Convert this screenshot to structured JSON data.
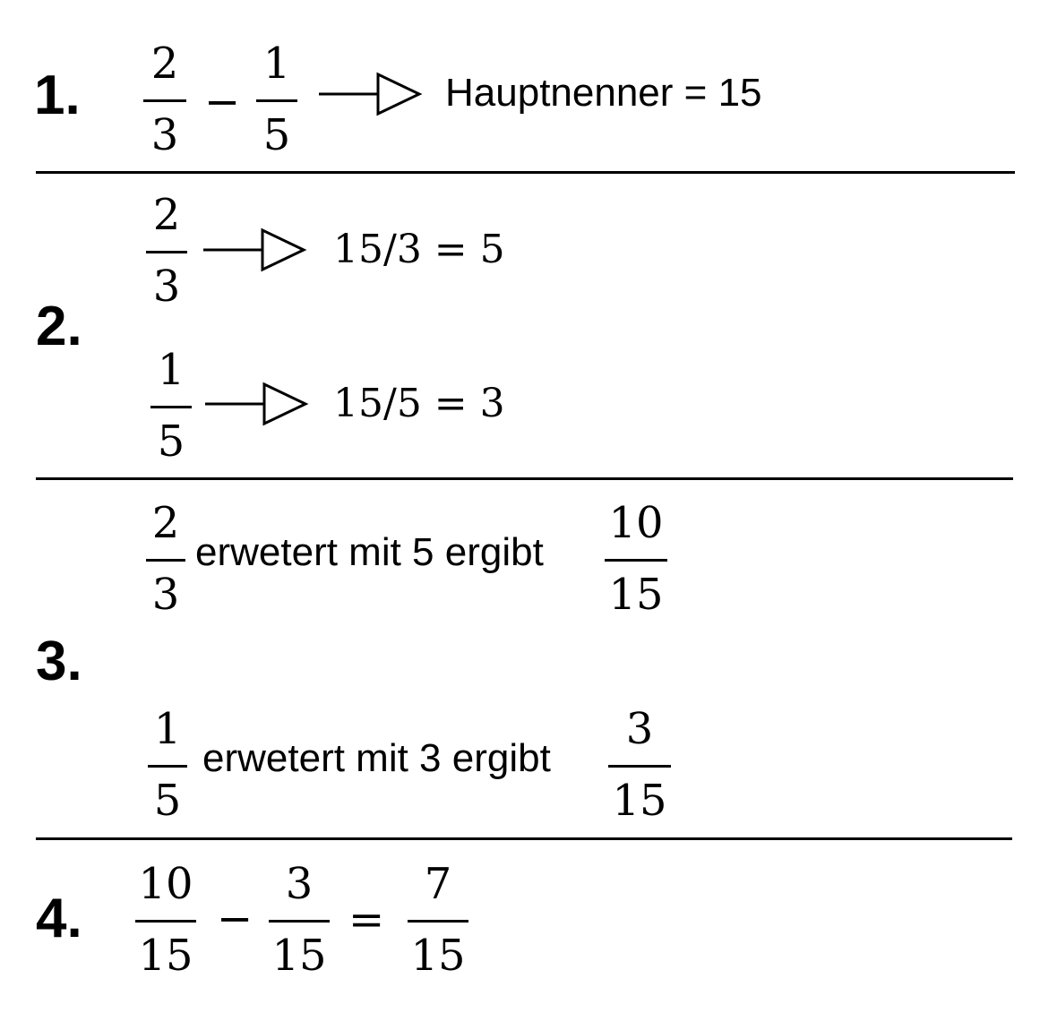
{
  "steps": [
    {
      "number": "1.",
      "expression": {
        "a": {
          "num": "2",
          "den": "3"
        },
        "op": "−",
        "b": {
          "num": "1",
          "den": "5"
        }
      },
      "note": "Hauptnenner = 15"
    },
    {
      "number": "2.",
      "rows": [
        {
          "frac": {
            "num": "2",
            "den": "3"
          },
          "result": "15/3 = 5"
        },
        {
          "frac": {
            "num": "1",
            "den": "5"
          },
          "result": "15/5 = 3"
        }
      ]
    },
    {
      "number": "3.",
      "rows": [
        {
          "frac": {
            "num": "2",
            "den": "3"
          },
          "text": "erwetert mit 5 ergibt",
          "result": {
            "num": "10",
            "den": "15"
          }
        },
        {
          "frac": {
            "num": "1",
            "den": "5"
          },
          "text": "erwetert mit 3 ergibt",
          "result": {
            "num": "3",
            "den": "15"
          }
        }
      ]
    },
    {
      "number": "4.",
      "expression": {
        "a": {
          "num": "10",
          "den": "15"
        },
        "op": "−",
        "b": {
          "num": "3",
          "den": "15"
        },
        "eq": "=",
        "c": {
          "num": "7",
          "den": "15"
        }
      }
    }
  ]
}
